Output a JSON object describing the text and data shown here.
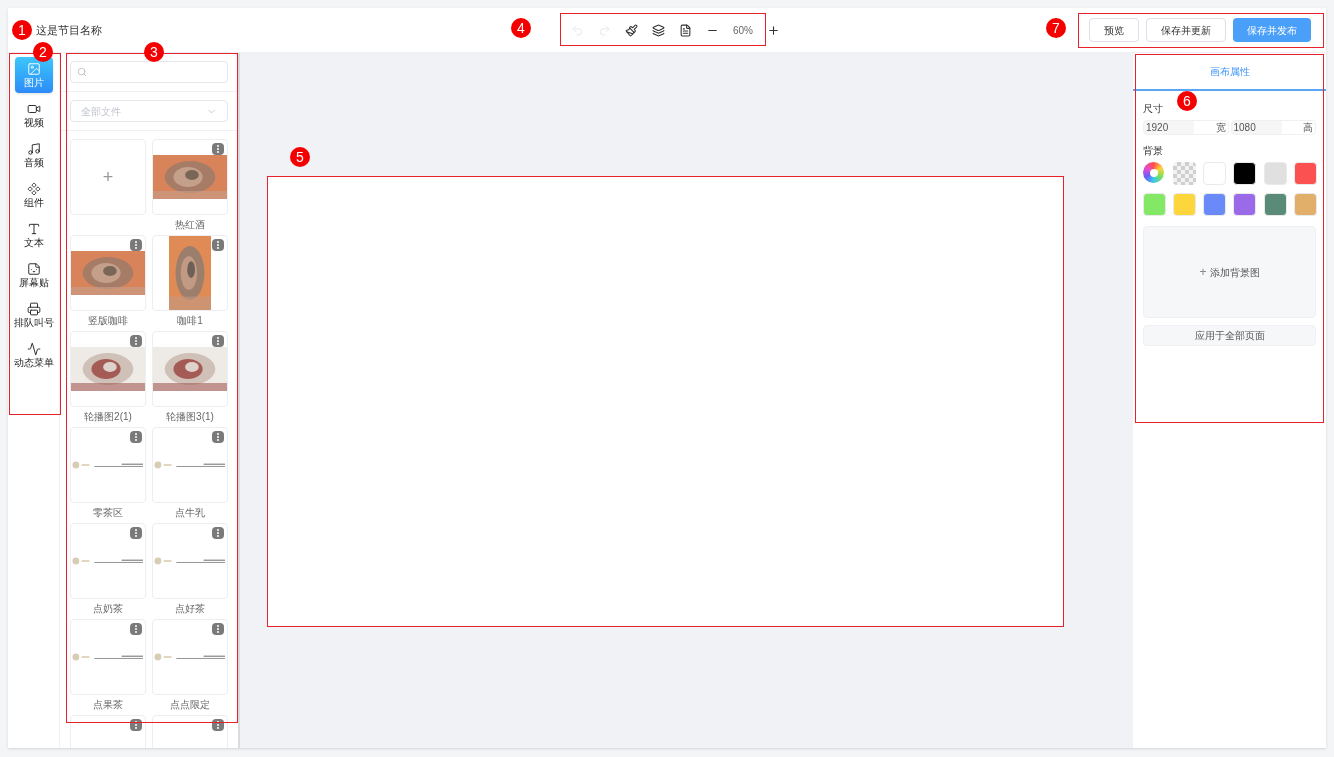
{
  "header": {
    "title": "这是节目名称"
  },
  "toolbar": {
    "tools": [
      {
        "kind": "undo",
        "disabled": true
      },
      {
        "kind": "redo",
        "disabled": true
      },
      {
        "kind": "brush",
        "disabled": false
      },
      {
        "kind": "layers",
        "disabled": false
      },
      {
        "kind": "file",
        "disabled": false
      },
      {
        "kind": "zoom-out",
        "disabled": false
      },
      {
        "kind": "zoom",
        "text": "60%"
      },
      {
        "kind": "zoom-in",
        "disabled": false
      }
    ]
  },
  "actions": [
    {
      "label": "预览",
      "kind": "default"
    },
    {
      "label": "保存并更新",
      "kind": "default"
    },
    {
      "label": "保存并发布",
      "kind": "primary"
    }
  ],
  "sidebar": {
    "items": [
      {
        "label": "图片",
        "selected": true
      },
      {
        "label": "视频",
        "kind": "video",
        "selected": false
      },
      {
        "label": "音频",
        "kind": "audio",
        "selected": false
      },
      {
        "label": "组件",
        "kind": "component",
        "selected": false
      },
      {
        "label": "文本",
        "kind": "text",
        "selected": false
      },
      {
        "label": "屏幕贴",
        "kind": "sticker",
        "selected": false
      },
      {
        "label": "排队叫号",
        "kind": "queue",
        "selected": false
      },
      {
        "label": "动态菜单",
        "kind": "menu",
        "selected": false
      }
    ]
  },
  "library": {
    "filter": "全部文件",
    "assets": [
      {
        "kind": "add",
        "text": "+"
      },
      {
        "name": "热红酒"
      },
      {
        "name": "竖版咖啡"
      },
      {
        "kind": "photo-tall",
        "name": "咖啡1"
      },
      {
        "kind": "photo-soft",
        "name": "轮播图2(1)"
      },
      {
        "kind": "photo-soft",
        "name": "轮播图3(1)"
      },
      {
        "kind": "menu",
        "name": "零茶区"
      },
      {
        "kind": "menu",
        "name": "点牛乳"
      },
      {
        "kind": "menu",
        "name": "点奶茶"
      },
      {
        "kind": "menu",
        "name": "点好茶"
      },
      {
        "kind": "menu",
        "name": "点果茶"
      },
      {
        "kind": "menu",
        "name": "点点限定"
      },
      {
        "kind": "cut"
      },
      {
        "kind": "cut"
      }
    ]
  },
  "properties": {
    "tab": {
      "label": "画布属性",
      "selected": true
    },
    "size_label": "尺寸",
    "width": {
      "value": "1920",
      "unit": "宽"
    },
    "height": {
      "value": "1080",
      "unit": "高"
    },
    "background_label": "背景",
    "swatches": [
      {
        "kind": "picker"
      },
      {
        "kind": "transparent"
      },
      {
        "kind": "color",
        "color": "#ffffff",
        "selected": false
      },
      {
        "kind": "color",
        "color": "#000000",
        "selected": false
      },
      {
        "kind": "color",
        "color": "#e0e0e0",
        "selected": false
      },
      {
        "kind": "color",
        "color": "#fc5151",
        "selected": false
      },
      {
        "kind": "color",
        "color": "#82e865",
        "selected": false
      },
      {
        "kind": "color",
        "color": "#fdd63b",
        "selected": false
      },
      {
        "kind": "color",
        "color": "#6a8afa",
        "selected": false
      },
      {
        "kind": "color",
        "color": "#9a6ae9",
        "selected": false
      },
      {
        "kind": "color",
        "color": "#5a8a78",
        "selected": false
      },
      {
        "kind": "color",
        "color": "#e1af6a",
        "selected": false
      }
    ],
    "add_background": {
      "icon": "+",
      "label": "添加背景图"
    },
    "apply_all": "应用于全部页面"
  },
  "annotations": [
    {
      "number": "1"
    },
    {
      "number": "2"
    },
    {
      "number": "3"
    },
    {
      "number": "4"
    },
    {
      "number": "5"
    },
    {
      "number": "6"
    },
    {
      "number": "7"
    }
  ]
}
